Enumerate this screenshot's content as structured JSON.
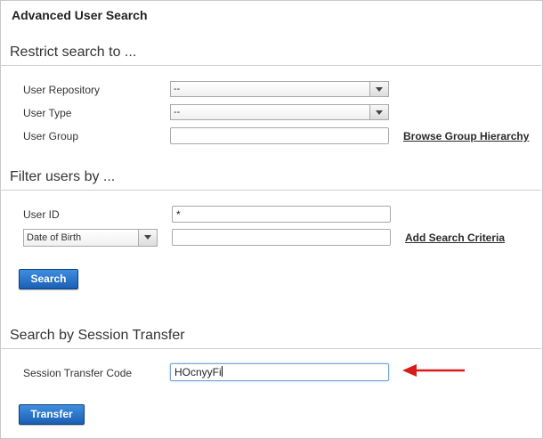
{
  "page": {
    "title": "Advanced User Search"
  },
  "restrict": {
    "heading": "Restrict search to ...",
    "user_repository": {
      "label": "User Repository",
      "value": "--"
    },
    "user_type": {
      "label": "User Type",
      "value": "--"
    },
    "user_group": {
      "label": "User Group",
      "value": ""
    },
    "browse_link": "Browse Group Hierarchy"
  },
  "filter": {
    "heading": "Filter users by ...",
    "user_id": {
      "label": "User ID",
      "value": "*"
    },
    "criteria_select": {
      "value": "Date of Birth"
    },
    "criteria_value": "",
    "add_criteria_link": "Add Search Criteria",
    "search_button": "Search"
  },
  "session": {
    "heading": "Search by Session Transfer",
    "code_label": "Session Transfer Code",
    "code_value": "HOcnyyFi",
    "transfer_button": "Transfer"
  },
  "annotation": {
    "arrow_color": "#d91a1a"
  }
}
